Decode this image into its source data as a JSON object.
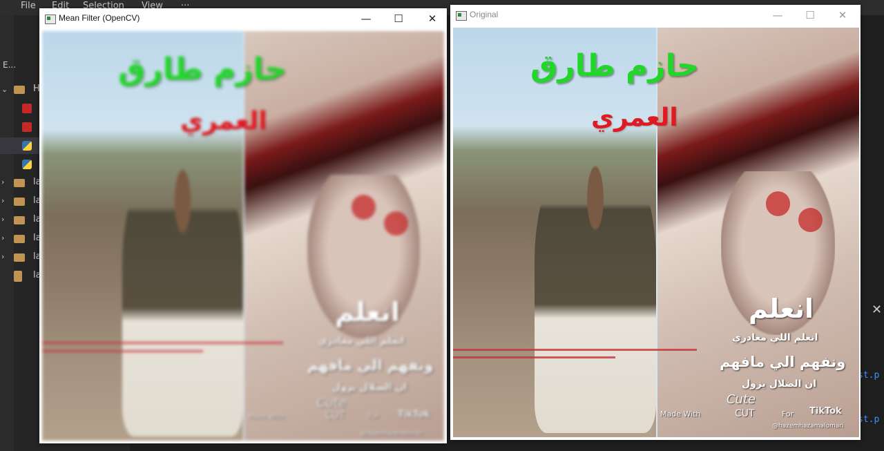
{
  "ide": {
    "menu": [
      "File",
      "Edit",
      "Selection",
      "View",
      "···"
    ],
    "explorer_label": "E...",
    "tree": [
      {
        "type": "folder-open",
        "label": "H"
      },
      {
        "type": "file-red",
        "label": ""
      },
      {
        "type": "file-red",
        "label": ""
      },
      {
        "type": "file-py",
        "label": ""
      },
      {
        "type": "file-py",
        "label": ""
      },
      {
        "type": "folder",
        "label": "la"
      },
      {
        "type": "folder",
        "label": "la"
      },
      {
        "type": "folder",
        "label": "la"
      },
      {
        "type": "folder",
        "label": "la"
      },
      {
        "type": "folder",
        "label": "la"
      },
      {
        "type": "file",
        "label": "la"
      }
    ],
    "terminal_lines": [
      "st.p",
      "st.p"
    ]
  },
  "windows": {
    "filtered": {
      "title": "Mean Filter (OpenCV)",
      "controls": {
        "minimize": "—",
        "maximize": "☐",
        "close": "✕"
      }
    },
    "original": {
      "title": "Original",
      "controls": {
        "minimize": "—",
        "maximize": "☐",
        "close": "✕"
      }
    }
  },
  "image_text": {
    "name_green": "حازم  طارق",
    "name_red": "العمري",
    "big_white": "انعلم",
    "line1": "انعلم اللي معادري",
    "line2": "ونفهم الي مافهم",
    "line3": "ان الضلال يزول",
    "made_with": "Made With",
    "cute": "Cute",
    "cut": "CUT",
    "for": "For",
    "tiktok": "TikTok",
    "handle_filtered": "@hazemhazamalomari",
    "handle_original": "@hazemhazamalomari"
  }
}
